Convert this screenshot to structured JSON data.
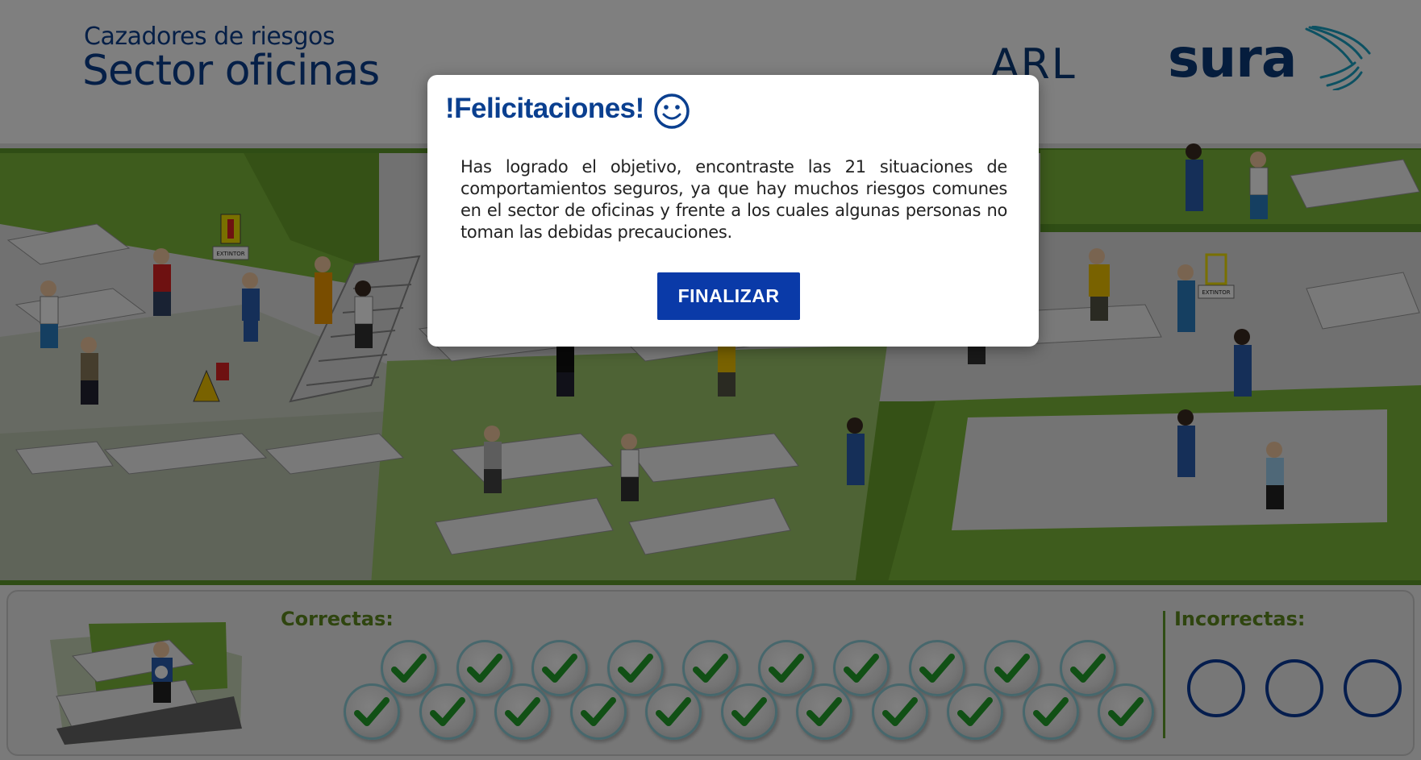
{
  "header": {
    "subtitle": "Cazadores de riesgos",
    "title": "Sector oficinas",
    "arl": "ARL",
    "brand": "sura"
  },
  "scene": {
    "extintor_label": "EXTINTOR",
    "extintor_label_2": "EXTINTOR"
  },
  "score": {
    "correct_label": "Correctas:",
    "incorrect_label": "Incorrectas:",
    "correct_count": 21,
    "incorrect_count": 0,
    "incorrect_slots": 3
  },
  "modal": {
    "title": "!Felicitaciones!",
    "icon": "smiley-icon",
    "body": "Has logrado el objetivo, encontraste las 21 situaciones de comportamientos seguros, ya que hay muchos riesgos comunes en el sector de oficinas y frente a los cuales algunas personas no toman las debidas precauciones.",
    "button_label": "FINALIZAR"
  },
  "colors": {
    "brand_blue": "#0a3f8f",
    "button_blue": "#0a3aa8",
    "green": "#5e9a2a",
    "check_green": "#22a12a",
    "overlay": "rgba(0,0,0,0.5)"
  }
}
